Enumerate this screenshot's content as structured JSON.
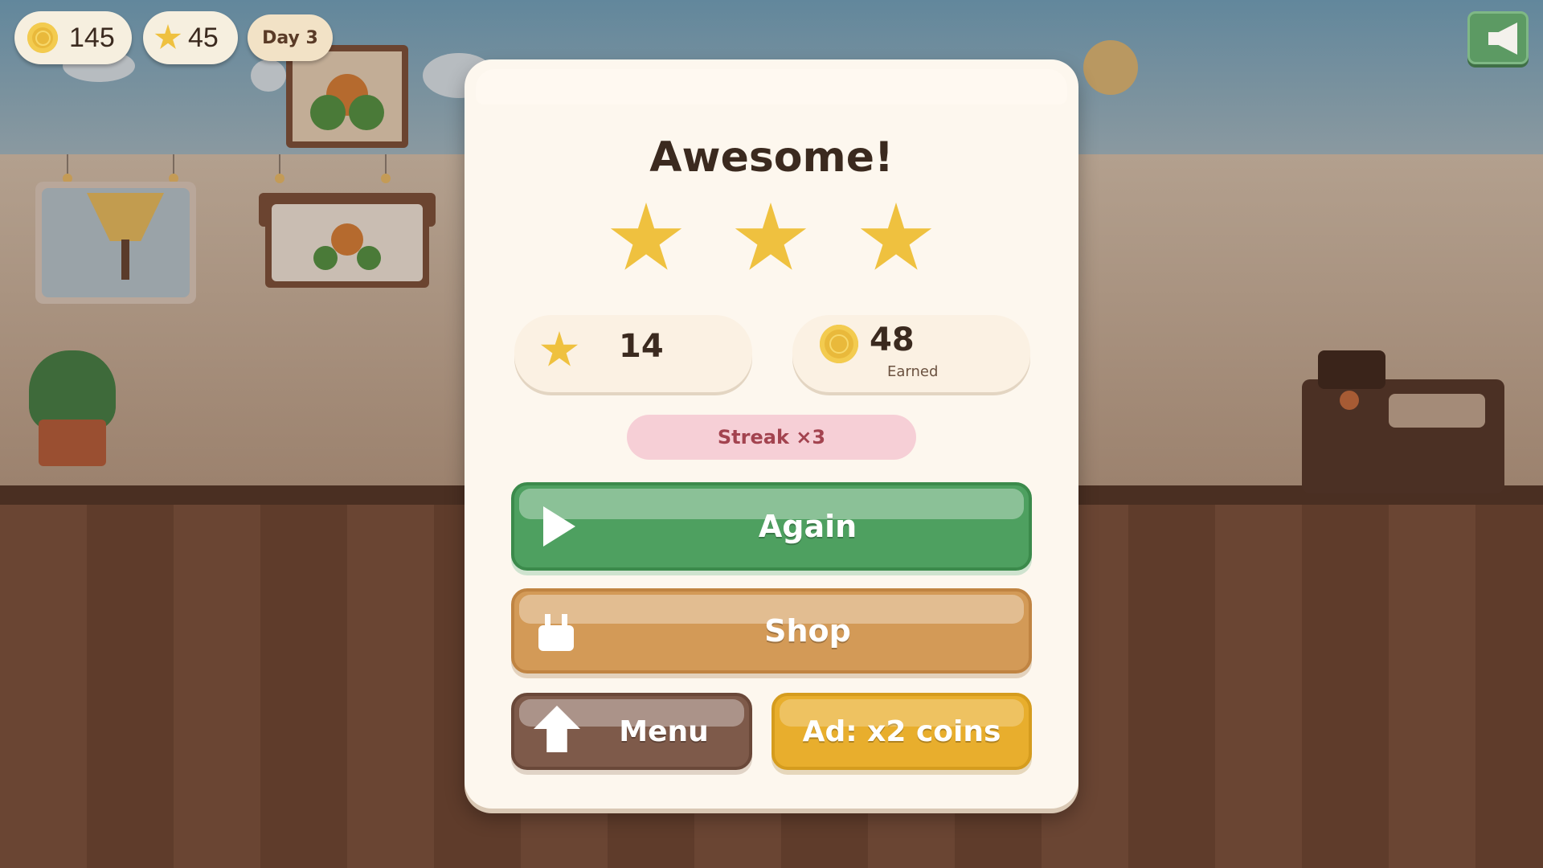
{
  "hud": {
    "coins": "145",
    "stars": "45",
    "day": "Day 3"
  },
  "sound_icon": "speaker-icon",
  "results": {
    "title": "Awesome!",
    "stars_earned": 3,
    "stars_total": 3,
    "score_stars": "14",
    "coins_earned": "48",
    "coins_label": "Earned",
    "streak": "Streak ×3"
  },
  "buttons": {
    "again": "Again",
    "shop": "Shop",
    "menu": "Menu",
    "ad": "Ad: x2 coins"
  },
  "colors": {
    "again": "#4ea060",
    "shop": "#d39a57",
    "menu": "#7e5a4a",
    "ad": "#e8ae2d",
    "star": "#efc13f"
  }
}
